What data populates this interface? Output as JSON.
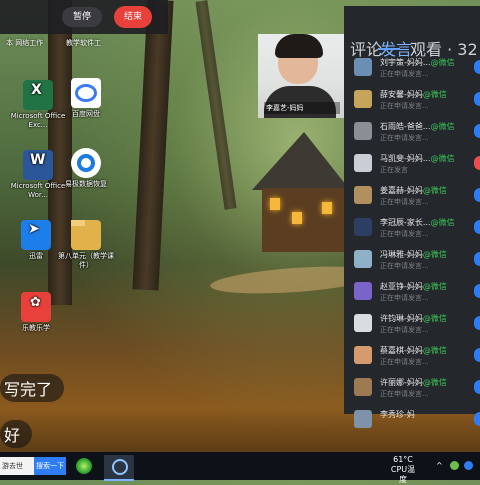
{
  "top_bar": {
    "pause_label": "暂停",
    "end_label": "结束"
  },
  "desktop_icons": [
    {
      "label": "Microsoft Office Exc...",
      "color": "#217346"
    },
    {
      "label": "百度网盘",
      "color": "#3a7bf4"
    },
    {
      "label": "Microsoft Office Wor...",
      "color": "#2b579a"
    },
    {
      "label": "易极数据恢复",
      "color": "#1b7be0"
    },
    {
      "label": "迅雷",
      "color": "#1c7ee8"
    },
    {
      "label": "第八单元（教学课件）",
      "color": "#e1b24a"
    },
    {
      "label": "乐教乐学",
      "color": "#e8413b"
    }
  ],
  "partial_top_labels": [
    "本 网络工作",
    "教学软件工"
  ],
  "left_edge_texts": [
    "写完了",
    "好"
  ],
  "video": {
    "name": "李嘉艺-妈妈"
  },
  "panel": {
    "tabs": [
      "评论",
      "发言",
      "观看 · 32"
    ],
    "active_tab": "发言",
    "entries": [
      {
        "name": "刘宇策-妈妈...",
        "tag": "@微信",
        "status": "正在申请发言...",
        "color": "#6b8fb3",
        "dot": "blue"
      },
      {
        "name": "薛安馨-妈妈",
        "tag": "@微信",
        "status": "正在申请发言...",
        "color": "#c6a55a",
        "dot": "blue"
      },
      {
        "name": "石雨皓-爸爸...",
        "tag": "@微信",
        "status": "正在申请发言...",
        "color": "#8a8f96",
        "dot": "blue"
      },
      {
        "name": "马凯斐-妈妈...",
        "tag": "@微信",
        "status": "正在发言",
        "color": "#c9ced6",
        "dot": "red"
      },
      {
        "name": "姜嘉赫-妈妈",
        "tag": "@微信",
        "status": "正在申请发言...",
        "color": "#b0905f",
        "dot": "blue"
      },
      {
        "name": "李冠辰-家长...",
        "tag": "@微信",
        "status": "正在申请发言...",
        "color": "#2c3e61",
        "dot": "blue"
      },
      {
        "name": "冯琳雅-妈妈",
        "tag": "@微信",
        "status": "正在申请发言...",
        "color": "#8fb0c9",
        "dot": "blue"
      },
      {
        "name": "赵亚铮-妈妈",
        "tag": "@微信",
        "status": "正在申请发言...",
        "color": "#7a63c9",
        "dot": "blue"
      },
      {
        "name": "许钧琳-妈妈",
        "tag": "@微信",
        "status": "正在申请发言...",
        "color": "#d9dde2",
        "dot": "blue"
      },
      {
        "name": "蔡嘉棋-妈妈",
        "tag": "@微信",
        "status": "正在申请发言...",
        "color": "#d59b6f",
        "dot": "blue"
      },
      {
        "name": "许丽娜-妈妈",
        "tag": "@微信",
        "status": "正在申请发言...",
        "color": "#9c7a52",
        "dot": "blue"
      },
      {
        "name": "李秀珍-妈",
        "tag": "",
        "status": "",
        "color": "#7e93aa",
        "dot": "blue"
      }
    ]
  },
  "taskbar": {
    "search_text": "游去世",
    "search_button": "搜索一下",
    "temperature": "61°C",
    "cpu_label": "CPU温度"
  }
}
